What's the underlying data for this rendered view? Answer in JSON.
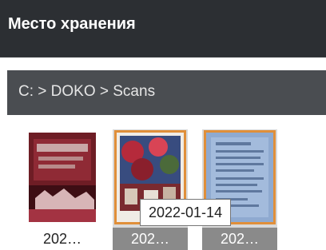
{
  "header": {
    "title": "Место хранения"
  },
  "breadcrumb": {
    "path": "C: > DOKO > Scans"
  },
  "thumbnails": [
    {
      "label": "202…",
      "icon": "scan-document-red-icon"
    },
    {
      "label": "202…",
      "icon": "scan-photo-icon"
    },
    {
      "label": "202…",
      "icon": "scan-text-document-icon"
    }
  ],
  "tooltip": {
    "text": "2022-01-14"
  },
  "colors": {
    "header_bg": "#2c2f33",
    "path_bg": "#4a4d51",
    "selection_accent": "#e08f3a"
  }
}
